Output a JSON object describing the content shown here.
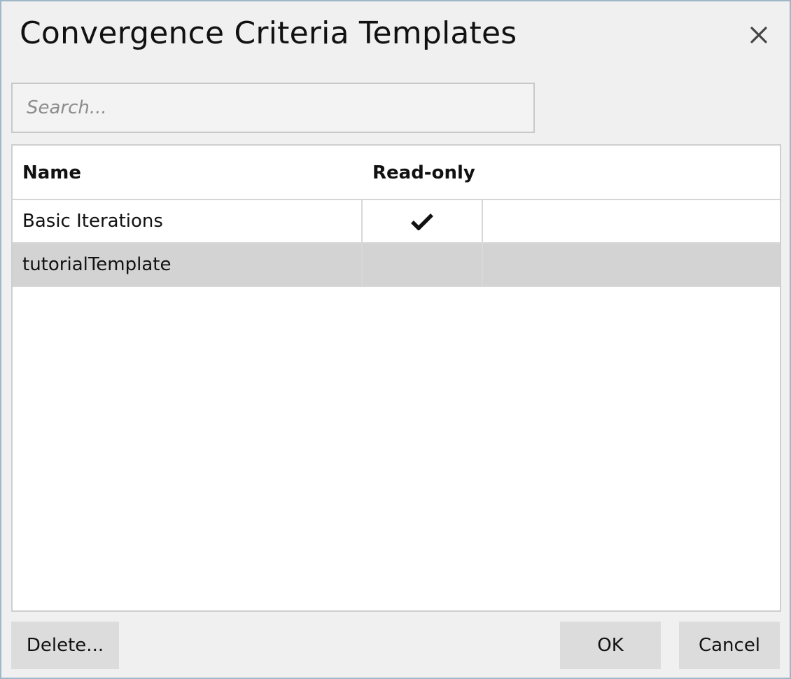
{
  "dialog": {
    "title": "Convergence Criteria Templates",
    "close_icon": "close-icon"
  },
  "search": {
    "placeholder": "Search...",
    "value": ""
  },
  "table": {
    "columns": [
      "Name",
      "Read-only"
    ],
    "rows": [
      {
        "name": "Basic Iterations",
        "read_only": true,
        "selected": false
      },
      {
        "name": "tutorialTemplate",
        "read_only": false,
        "selected": true
      }
    ],
    "row_selected_color": "#d3d3d3"
  },
  "buttons": {
    "delete": "Delete...",
    "ok": "OK",
    "cancel": "Cancel"
  }
}
